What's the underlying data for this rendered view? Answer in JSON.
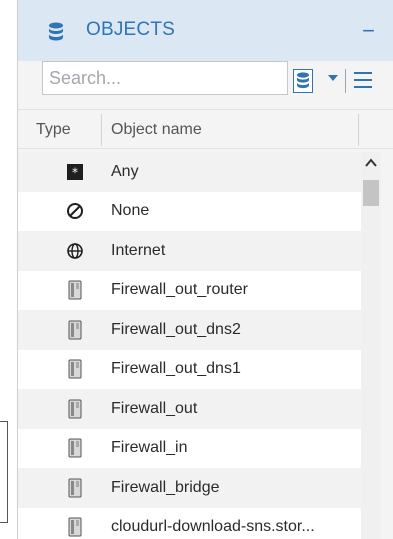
{
  "panel": {
    "title": "OBJECTS",
    "collapse_label": "−",
    "search_placeholder": "Search...",
    "columns": {
      "type": "Type",
      "name": "Object name"
    },
    "rows": [
      {
        "icon": "any-icon",
        "name": "Any"
      },
      {
        "icon": "none-icon",
        "name": "None"
      },
      {
        "icon": "globe-icon",
        "name": "Internet"
      },
      {
        "icon": "firewall-icon",
        "name": "Firewall_out_router"
      },
      {
        "icon": "firewall-icon",
        "name": "Firewall_out_dns2"
      },
      {
        "icon": "firewall-icon",
        "name": "Firewall_out_dns1"
      },
      {
        "icon": "firewall-icon",
        "name": "Firewall_out"
      },
      {
        "icon": "firewall-icon",
        "name": "Firewall_in"
      },
      {
        "icon": "firewall-icon",
        "name": "Firewall_bridge"
      },
      {
        "icon": "firewall-icon",
        "name": "cloudurl-download-sns.stor..."
      }
    ]
  },
  "colors": {
    "accent": "#2f74b5",
    "header_bg": "#dbe8f4"
  }
}
